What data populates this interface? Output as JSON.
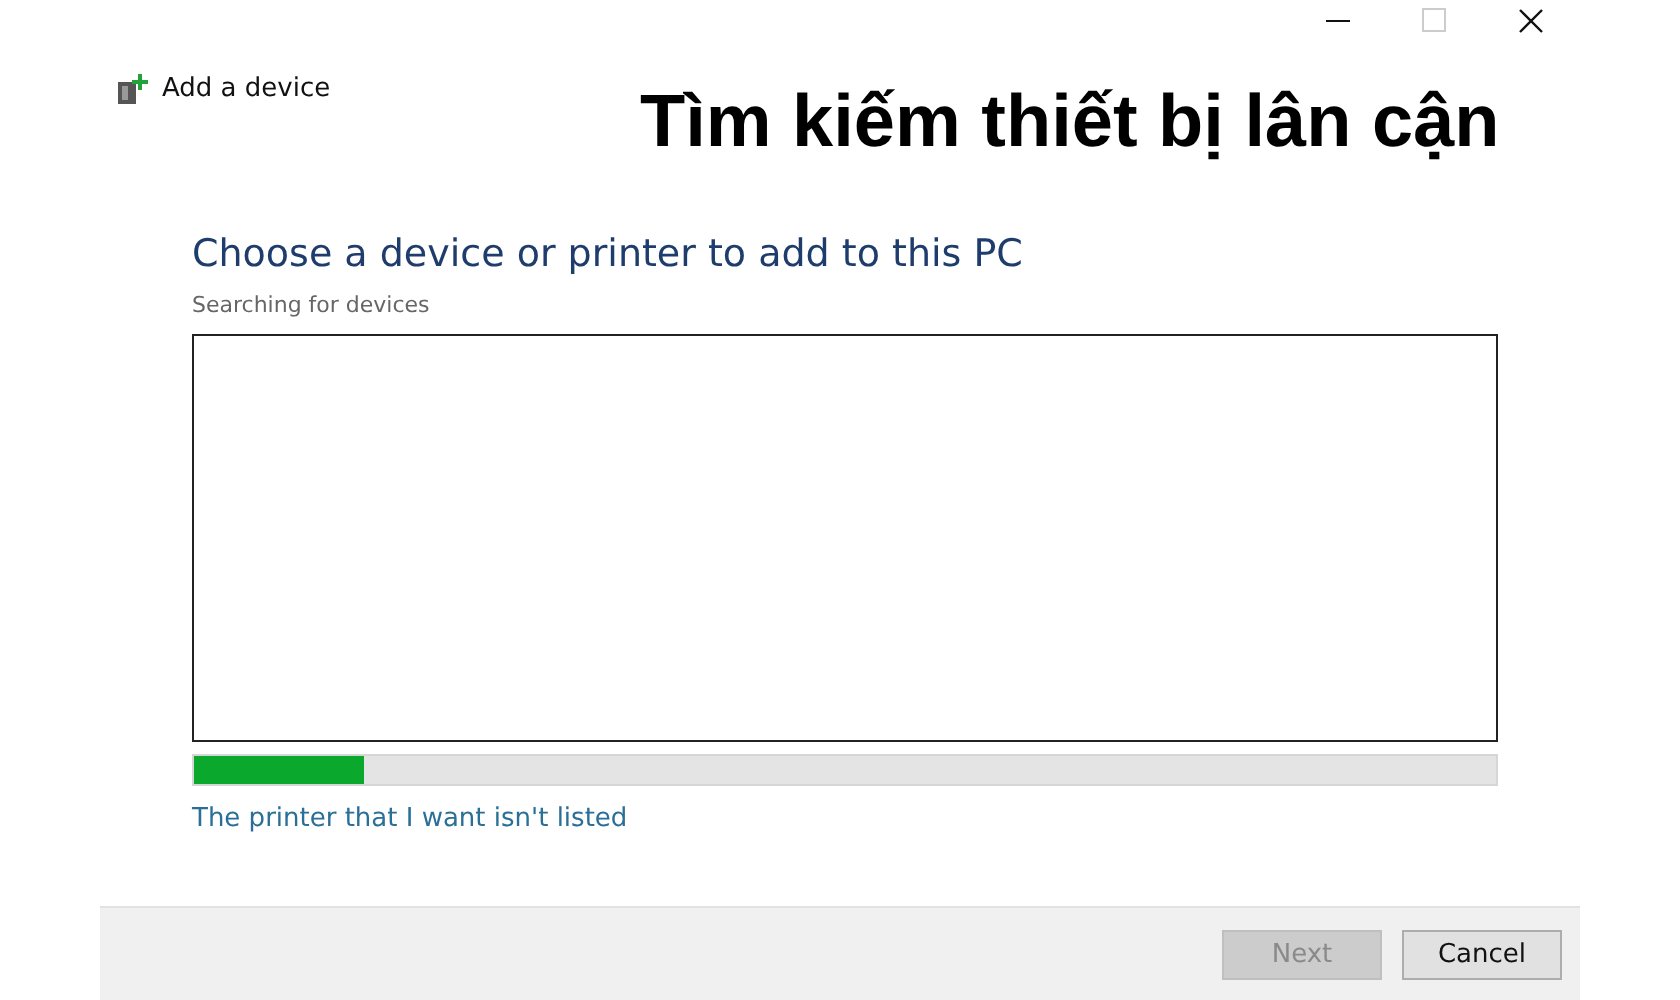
{
  "window": {
    "title": "Add a device"
  },
  "caption": "Tìm kiếm thiết bị lân cận",
  "heading": "Choose a device or printer to add to this PC",
  "status": "Searching for devices",
  "progress": {
    "level": 0.13
  },
  "link": "The printer that I want isn't listed",
  "buttons": [
    {
      "label": "Next",
      "disabled": true
    },
    {
      "label": "Cancel",
      "disabled": false
    }
  ]
}
